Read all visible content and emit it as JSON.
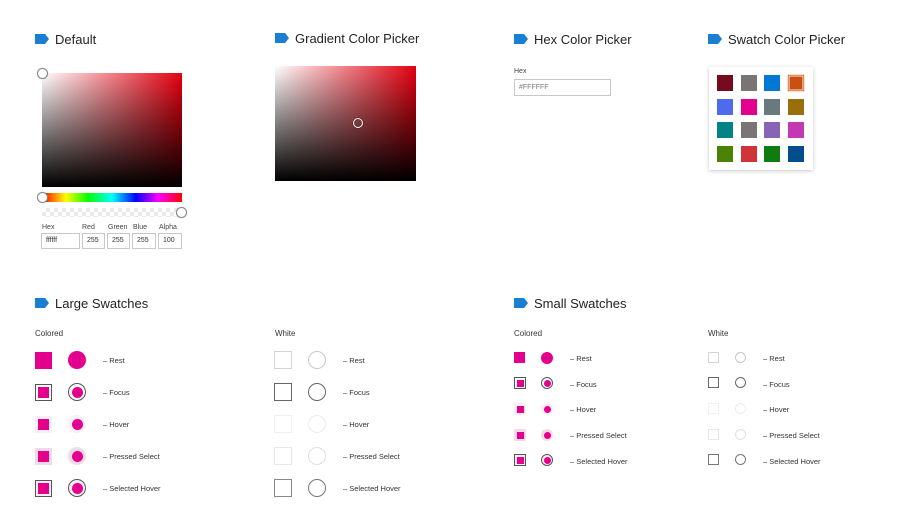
{
  "sections": {
    "default": "Default",
    "gradient": "Gradient Color Picker",
    "hex": "Hex Color Picker",
    "swatch": "Swatch Color Picker",
    "large": "Large Swatches",
    "small": "Small Swatches"
  },
  "default_picker": {
    "hex_label": "Hex",
    "red_label": "Red",
    "green_label": "Green",
    "blue_label": "Blue",
    "alpha_label": "Alpha",
    "hex_value": "ffffff",
    "red_value": "255",
    "green_value": "255",
    "blue_value": "255",
    "alpha_value": "100"
  },
  "hex_picker": {
    "label": "Hex",
    "value": "#FFFFFF"
  },
  "swatch_colors": [
    "#750b1c",
    "#7a7574",
    "#0078d4",
    "#ca5010",
    "#4f6bed",
    "#e3008c",
    "#69797e",
    "#986f0b",
    "#038387",
    "#7a7574",
    "#8764b8",
    "#c239b3",
    "#498205",
    "#d13438",
    "#107c10",
    "#004e8c"
  ],
  "accent": "#e3008c",
  "large": {
    "colored_label": "Colored",
    "white_label": "White",
    "states": [
      "– Rest",
      "– Focus",
      "– Hover",
      "– Pressed Select",
      "– Selected Hover"
    ]
  },
  "small": {
    "colored_label": "Colored",
    "white_label": "White",
    "states": [
      "– Rest",
      "– Focus",
      "– Hover",
      "– Pressed Select",
      "– Selected Hover"
    ]
  }
}
